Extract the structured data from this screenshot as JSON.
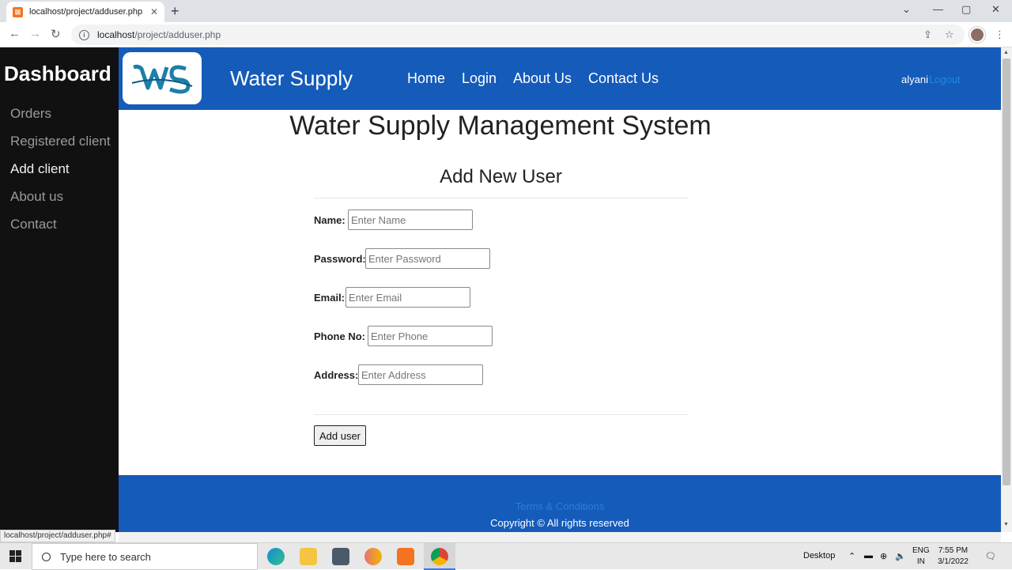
{
  "browser": {
    "tab_title": "localhost/project/adduser.php",
    "url_host": "localhost",
    "url_path": "/project/adduser.php",
    "status_url": "localhost/project/adduser.php#"
  },
  "sidebar": {
    "title": "Dashboard",
    "items": [
      {
        "label": "Orders",
        "active": false
      },
      {
        "label": "Registered client",
        "active": false
      },
      {
        "label": "Add client",
        "active": true
      },
      {
        "label": "About us",
        "active": false
      },
      {
        "label": "Contact",
        "active": false
      }
    ]
  },
  "header": {
    "brand": "Water Supply",
    "logo_text": "WS",
    "nav": [
      "Home",
      "Login",
      "About Us",
      "Contact Us"
    ],
    "user": "alyani",
    "logout": "Logout"
  },
  "main": {
    "title": "Water Supply Management System",
    "form_title": "Add New User",
    "fields": [
      {
        "label": "Name:",
        "placeholder": "Enter Name"
      },
      {
        "label": "Password:",
        "placeholder": "Enter Password"
      },
      {
        "label": "Email:",
        "placeholder": "Enter Email"
      },
      {
        "label": "Phone No:",
        "placeholder": "Enter Phone"
      },
      {
        "label": "Address:",
        "placeholder": "Enter Address"
      }
    ],
    "submit": "Add user"
  },
  "footer": {
    "terms": "Terms & Conditions",
    "copyright": "Copyright © All rights reserved"
  },
  "taskbar": {
    "search_placeholder": "Type here to search",
    "desktop": "Desktop",
    "lang_1": "ENG",
    "lang_2": "IN",
    "time": "7:55 PM",
    "date": "3/1/2022"
  },
  "colors": {
    "header_blue": "#155bba",
    "sidebar_bg": "#111111",
    "logout_link": "#1e88e5"
  }
}
